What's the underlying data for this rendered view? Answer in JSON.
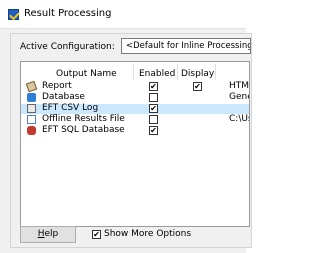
{
  "window": {
    "title": "Result Processing"
  },
  "config": {
    "label": "Active Configuration:",
    "value": "<Default for Inline Processing>"
  },
  "table": {
    "columns": [
      "Output Name",
      "Enabled",
      "Display"
    ],
    "rows": [
      {
        "name": "Report",
        "icon": "report-icon",
        "enabled": "✔",
        "display": "✔",
        "target": "HTML"
      },
      {
        "name": "Database",
        "icon": "database-icon",
        "enabled": "",
        "display": "",
        "target": "Gener"
      },
      {
        "name": "EFT CSV Log",
        "icon": "csv-log-icon",
        "enabled": "✔",
        "display": "",
        "target": "",
        "selected": true
      },
      {
        "name": "Offline Results File",
        "icon": "file-icon",
        "enabled": "",
        "display": "",
        "target": "C:\\Use"
      },
      {
        "name": "EFT SQL Database",
        "icon": "sql-database-icon",
        "enabled": "✔",
        "display": "",
        "target": ""
      }
    ]
  },
  "footer": {
    "help_accel": "H",
    "help_rest": "elp",
    "show_more_checked": "✔",
    "show_more_label": "Show More Options"
  }
}
